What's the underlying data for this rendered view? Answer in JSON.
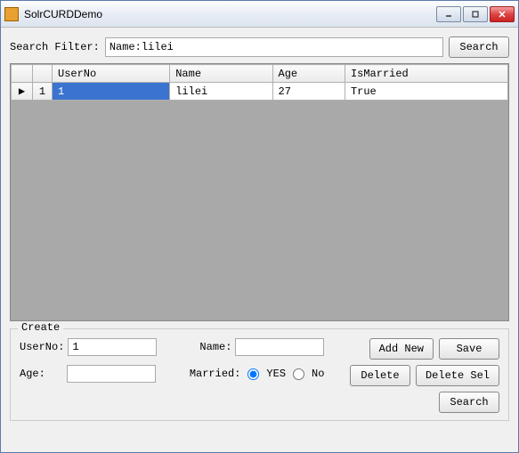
{
  "window": {
    "title": "SolrCURDDemo"
  },
  "search": {
    "label": "Search Filter:",
    "value": "Name:lilei",
    "button": "Search"
  },
  "grid": {
    "columns": [
      "UserNo",
      "Name",
      "Age",
      "IsMarried"
    ],
    "rows": [
      {
        "indicator": "▶",
        "index": "1",
        "cells": [
          "1",
          "lilei",
          "27",
          "True"
        ],
        "selectedCol": 0
      }
    ]
  },
  "create": {
    "legend": "Create",
    "fields": {
      "userno_label": "UserNo:",
      "userno_value": "1",
      "name_label": "Name:",
      "name_value": "",
      "age_label": "Age:",
      "age_value": "",
      "married_label": "Married:",
      "married_yes": "YES",
      "married_no": "No",
      "married_selected": "YES"
    },
    "buttons": {
      "add_new": "Add New",
      "save": "Save",
      "delete": "Delete",
      "delete_sel": "Delete Sel",
      "search": "Search"
    }
  }
}
